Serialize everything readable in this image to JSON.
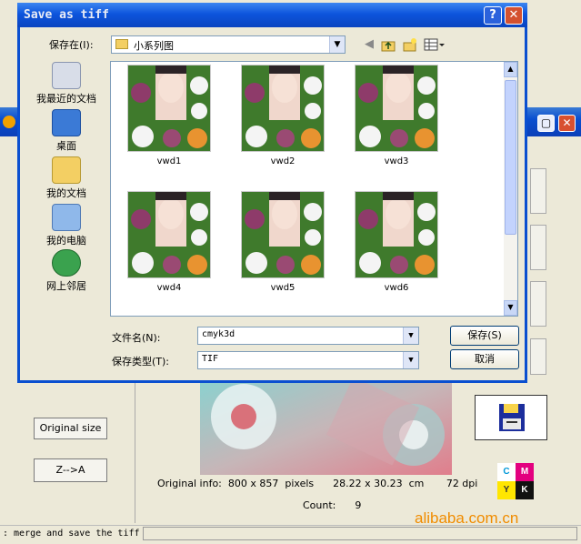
{
  "dialog": {
    "title": "Save as tiff",
    "help_glyph": "?",
    "close_glyph": "✕",
    "save_in_label": "保存在(I):",
    "save_in_value": "小系列图",
    "places": [
      {
        "label": "我最近的文档",
        "icon": "recent-documents-icon"
      },
      {
        "label": "桌面",
        "icon": "desktop-icon"
      },
      {
        "label": "我的文档",
        "icon": "my-documents-icon"
      },
      {
        "label": "我的电脑",
        "icon": "my-computer-icon"
      },
      {
        "label": "网上邻居",
        "icon": "network-places-icon"
      }
    ],
    "files": [
      "vwd1",
      "vwd2",
      "vwd3",
      "vwd4",
      "vwd5",
      "vwd6"
    ],
    "filename_label": "文件名(N):",
    "filename_value": "cmyk3d",
    "filetype_label": "保存类型(T):",
    "filetype_value": "TIF",
    "save_button": "保存(S)",
    "cancel_button": "取消"
  },
  "app": {
    "original_size_button": "Original size",
    "z_to_a_button": "Z-->A",
    "info_line": "Original info:  800 x 857  pixels      28.22 x 30.23  cm       72 dpi",
    "count_label": "Count:",
    "count_value": "9",
    "status_text": ": merge and save the tiff",
    "cmyk_letters": [
      "C",
      "M",
      "Y",
      "K"
    ],
    "watermark": "alibaba.com.cn"
  },
  "colors": {
    "title_bar": "#0a4fd0",
    "dialog_bg": "#ece9d8",
    "watermark": "#f08c00"
  }
}
